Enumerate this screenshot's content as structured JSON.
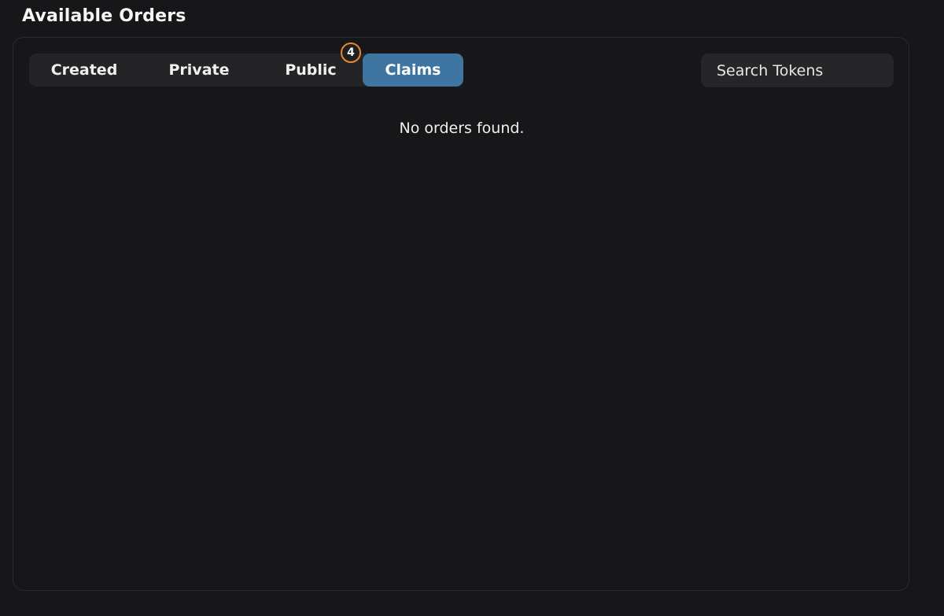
{
  "header": {
    "title": "Available Orders"
  },
  "tabs": [
    {
      "label": "Created",
      "active": false
    },
    {
      "label": "Private",
      "active": false
    },
    {
      "label": "Public",
      "active": false,
      "badge": "4"
    },
    {
      "label": "Claims",
      "active": true
    }
  ],
  "search": {
    "placeholder": "Search Tokens",
    "value": ""
  },
  "content": {
    "empty_message": "No orders found."
  },
  "colors": {
    "background": "#171719",
    "tab_bar": "#242427",
    "active_tab": "#3f76a1",
    "badge_border": "#e58a2b"
  }
}
